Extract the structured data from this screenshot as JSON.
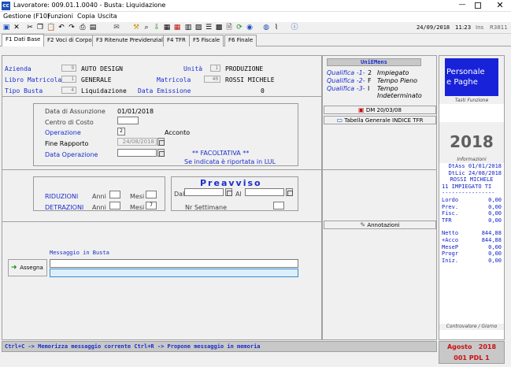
{
  "window": {
    "title": "Lavoratore: 009.01.1.0040 - Busta: Liquidazione",
    "app_icon_text": "cc"
  },
  "menu": [
    "Gestione (F10)",
    "Funzioni",
    "Copia",
    "Uscita"
  ],
  "toolbar_right": {
    "date": "24/09/2018",
    "time": "11:23",
    "mode": "Ins",
    "code": "R3811"
  },
  "tabs": [
    "F1 Dati Base",
    "F2 Voci di Corpo",
    "F3 Ritenute Previdenziali",
    "F4 TFR",
    "F5 Fiscale",
    "F6 Finale"
  ],
  "header": {
    "azienda_label": "Azienda",
    "azienda_code": "9",
    "azienda_name": "AUTO DESIGN",
    "unita_label": "Unità",
    "unita_code": "1",
    "unita_name": "PRODUZIONE",
    "libro_label": "Libro Matricola",
    "libro_code": "1",
    "libro_name": "GENERALE",
    "matricola_label": "Matricola",
    "matricola_code": "40",
    "matricola_name": "ROSSI MICHELE",
    "tipo_label": "Tipo Busta",
    "tipo_code": "4",
    "tipo_name": "Liquidazione",
    "emissione_label": "Data Emissione",
    "emissione_value": "0"
  },
  "uniemens": {
    "title": "UniEMens",
    "rows": [
      {
        "label": "Qualifica -1-",
        "code": "2",
        "value": "Impiegato"
      },
      {
        "label": "Qualifica -2-",
        "code": "F",
        "value": "Tempo Pieno"
      },
      {
        "label": "Qualifica -3-",
        "code": "I",
        "value": "Tempo Indeterminato"
      }
    ]
  },
  "dati": {
    "assunzione_label": "Data di Assunzione",
    "assunzione_value": "01/01/2018",
    "centro_label": "Centro di Costo",
    "operazione_label": "Operazione",
    "operazione_code": "2",
    "operazione_value": "Acconto",
    "fine_label": "Fine Rapporto",
    "fine_value": "24/08/2018",
    "data_op_label": "Data Operazione",
    "facoltativa": "** FACOLTATIVA **",
    "facoltativa_note": "Se indicata è riportata in LUL"
  },
  "actions": {
    "dm_label": "DM 20/03/08",
    "tabella_label": "Tabella Generale INDICE TFR",
    "annotazioni_label": "Annotazioni",
    "assegna_label": "Assegna"
  },
  "riduzioni": {
    "riduzioni_label": "RIDUZIONI",
    "detrazioni_label": "DETRAZIONI",
    "anni_label": "Anni",
    "mesi_label": "Mesi",
    "detrazioni_mesi": "7"
  },
  "preavviso": {
    "title": "Preavviso",
    "dal_label": "Dal",
    "al_label": "Al",
    "settimane_label": "Nr Settimane"
  },
  "messaggio": {
    "label": "Messaggio in Busta"
  },
  "status": {
    "hint": "Ctrl+C -> Memorizza messaggio corrente  Ctrl+R -> Propone messaggio in memoria",
    "period": "Agosto   2018",
    "pdl": "001 PDL 1"
  },
  "sidebar": {
    "logo_line1": "Personale",
    "logo_line2": "e Paghe",
    "tasti_label": "Tasti Funzione",
    "year": "2018",
    "info_label": "Informazioni",
    "dtass": "DtAss 01/01/2018",
    "dtlic": "DtLic 24/08/2018",
    "name": "ROSSI MICHELE",
    "qual": "11   IMPIEGATO TI",
    "separator": "----------------",
    "values": [
      {
        "k": "Lordo",
        "v": "0,00"
      },
      {
        "k": "Prev.",
        "v": "0,00"
      },
      {
        "k": "Fisc.",
        "v": "0,00"
      },
      {
        "k": "TFR",
        "v": "0,00"
      }
    ],
    "values2": [
      {
        "k": "Netto",
        "v": "844,88"
      },
      {
        "k": "+Acco",
        "v": "844,88"
      },
      {
        "k": "MeseP",
        "v": "0,00"
      },
      {
        "k": "Progr",
        "v": "0,00"
      },
      {
        "k": "Iniz.",
        "v": "0,00"
      }
    ],
    "controvalore_label": "Controvalore / Giorno"
  },
  "colors": {
    "accent_blue": "#1a2ecc",
    "logo_bg": "#1822d8",
    "sidebar_text": "#1022c8",
    "period_red": "#cc1010",
    "status_bg": "#c8c8c8"
  }
}
